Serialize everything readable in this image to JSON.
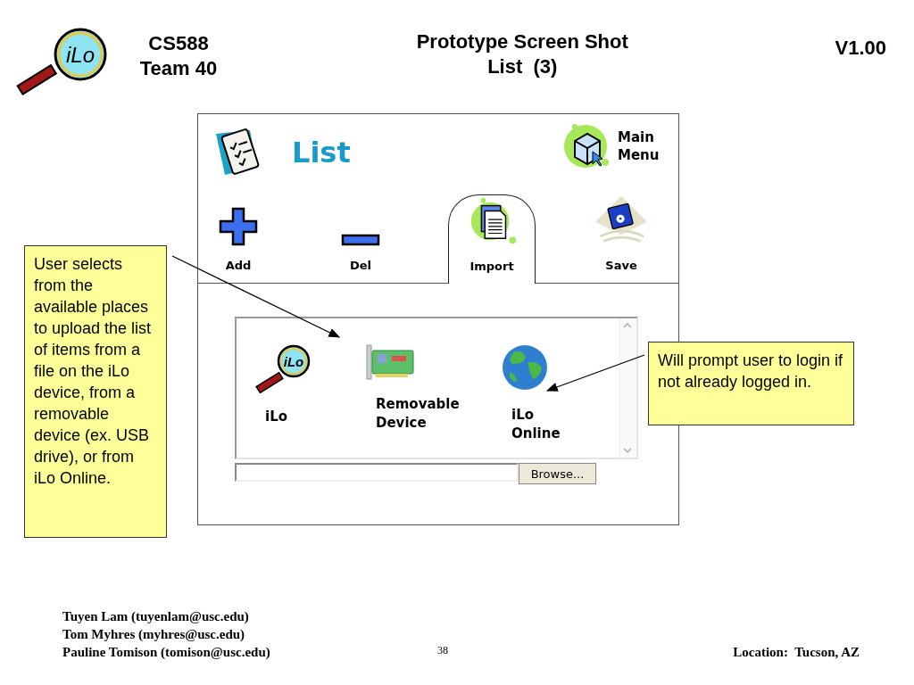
{
  "slide": {
    "logo_text": "iLo",
    "team": [
      "CS588",
      "Team 40"
    ],
    "title": [
      "Prototype Screen Shot",
      "List  (3)"
    ],
    "version": "V1.00"
  },
  "app": {
    "title": "List",
    "main_menu": "Main Menu",
    "toolbar": [
      {
        "label": "Add",
        "kind": "add",
        "selected": false
      },
      {
        "label": "Del",
        "kind": "del",
        "selected": false
      },
      {
        "label": "Import",
        "kind": "import",
        "selected": true
      },
      {
        "label": "Save",
        "kind": "save",
        "selected": false
      }
    ],
    "sources": [
      {
        "label": "iLo",
        "kind": "ilo",
        "icon_text": "iLo"
      },
      {
        "label": "Removable Device",
        "kind": "card"
      },
      {
        "label": "iLo Online",
        "kind": "globe"
      }
    ],
    "browse_button": "Browse..."
  },
  "callouts": [
    {
      "kind": "left",
      "text": "User selects from the available places to upload the list of items from a file on the iLo device, from a removable device (ex. USB drive), or from iLo Online."
    },
    {
      "kind": "right",
      "text": "Will prompt user to login if not already logged in."
    }
  ],
  "footer": {
    "authors": [
      "Tuyen Lam (tuyenlam@usc.edu)",
      "Tom Myhres (myhres@usc.edu)",
      "Pauline Tomison (tomison@usc.edu)"
    ],
    "page_number": "38",
    "location": "Location:  Tucson, AZ"
  }
}
